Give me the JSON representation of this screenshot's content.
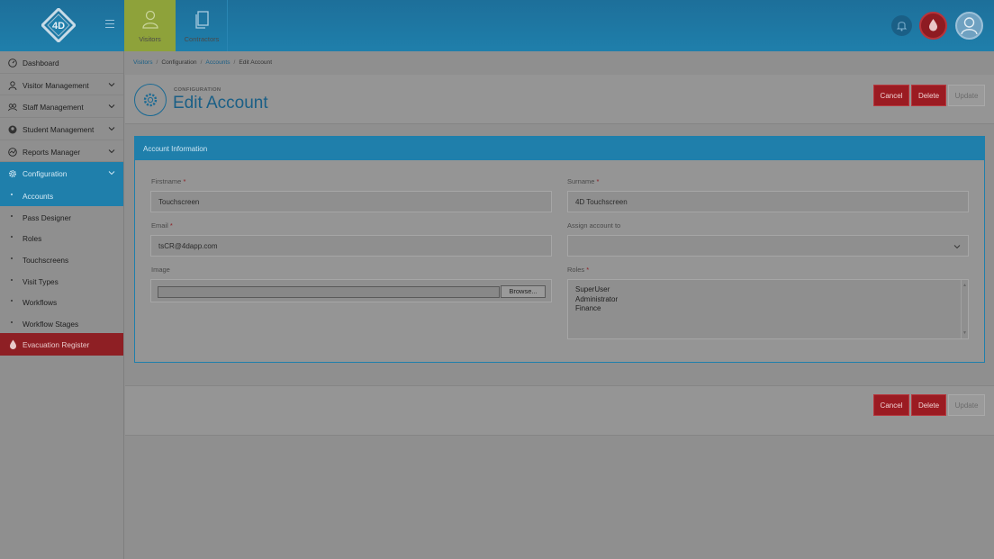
{
  "topbar": {
    "tabs": [
      {
        "label": "Visitors",
        "icon": "user-icon"
      },
      {
        "label": "Contractors",
        "icon": "document-icon"
      }
    ]
  },
  "sidebar": {
    "items": [
      {
        "label": "Dashboard",
        "icon": "dashboard-icon"
      },
      {
        "label": "Visitor Management",
        "icon": "user-icon"
      },
      {
        "label": "Staff Management",
        "icon": "staff-icon"
      },
      {
        "label": "Student Management",
        "icon": "student-icon"
      },
      {
        "label": "Reports Manager",
        "icon": "chart-icon"
      },
      {
        "label": "Configuration",
        "icon": "gear-icon"
      }
    ],
    "subitems": [
      "Accounts",
      "Pass Designer",
      "Roles",
      "Touchscreens",
      "Visit Types",
      "Workflows",
      "Workflow Stages"
    ],
    "evacuation": "Evacuation Register"
  },
  "breadcrumb": [
    "Visitors",
    "Configuration",
    "Accounts",
    "Edit Account"
  ],
  "header": {
    "kicker": "CONFIGURATION",
    "title": "Edit Account"
  },
  "actions": {
    "cancel": "Cancel",
    "delete": "Delete",
    "update": "Update"
  },
  "panel": {
    "title": "Account Information",
    "firstname_label": "Firstname",
    "firstname_value": "Touchscreen",
    "surname_label": "Surname",
    "surname_value": "4D Touchscreen",
    "email_label": "Email",
    "email_value": "tsCR@4dapp.com",
    "assign_label": "Assign account to",
    "assign_value": "",
    "image_label": "Image",
    "browse_label": "Browse...",
    "roles_label": "Roles",
    "roles": [
      "SuperUser",
      "Administrator",
      "Finance"
    ],
    "required_mark": "*"
  },
  "colors": {
    "primary": "#1f7fab",
    "danger": "#9b1b22",
    "accent_tab": "#8ea23a"
  }
}
